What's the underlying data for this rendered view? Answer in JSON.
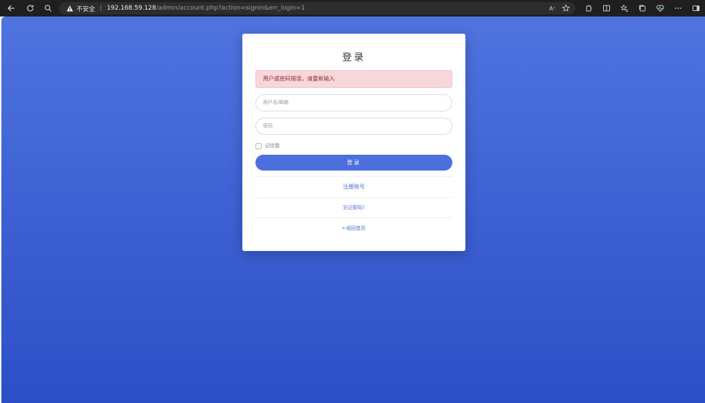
{
  "browser": {
    "insecure_label": "不安全",
    "url_host": "192.168.59.128",
    "url_path": "/admin/account.php?action=signin&err_login=1",
    "read_aloud_label": "A"
  },
  "login": {
    "title": "登录",
    "error_message": "用户或密码错误，请重新输入",
    "username_placeholder": "用户名/邮箱",
    "password_placeholder": "密码",
    "remember_label": "记住我",
    "submit_label": "登录",
    "register_link": "注册账号",
    "forgot_link": "忘记密码?",
    "home_link": "←返回首页"
  },
  "colors": {
    "accent": "#4b70dd",
    "alert_bg": "#f8d7da",
    "background_top": "#4f74e0",
    "background_bottom": "#2c4fc6"
  }
}
